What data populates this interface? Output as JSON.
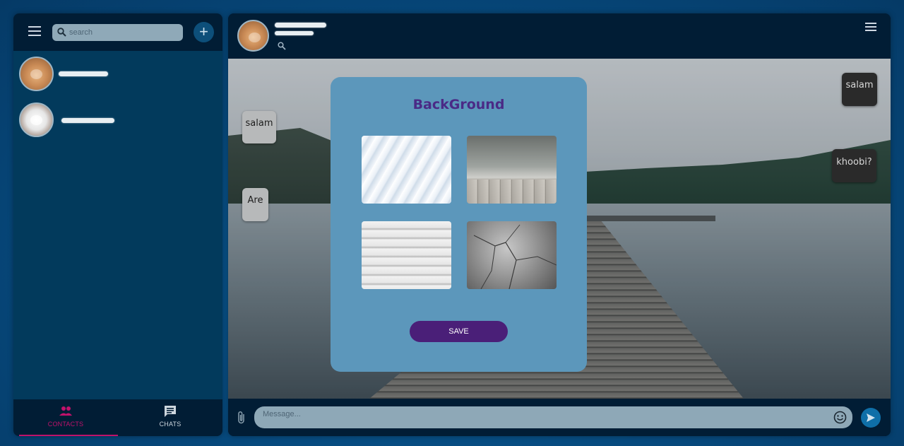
{
  "sidebar": {
    "search_placeholder": "search",
    "add_label": "+",
    "contacts": [
      {
        "avatar": "cat-avatar"
      },
      {
        "avatar": "dog-avatar"
      }
    ]
  },
  "bottom_nav": {
    "contacts_label": "CONTACTS",
    "chats_label": "CHATS",
    "active_tab": "contacts",
    "active_color": "#c1126b"
  },
  "chat": {
    "messages": [
      {
        "text": "salam",
        "direction": "incoming"
      },
      {
        "text": "Are",
        "direction": "incoming"
      },
      {
        "text": "salam",
        "direction": "outgoing"
      },
      {
        "text": "khoobi?",
        "direction": "outgoing"
      }
    ],
    "message_placeholder": "Message..."
  },
  "modal": {
    "title": "BackGround",
    "options": [
      "light-diagonal-texture",
      "wooden-deck-texture",
      "white-wood-planks",
      "cracked-concrete"
    ],
    "save_label": "SAVE"
  },
  "colors": {
    "sidebar_bg": "#023a5c",
    "header_bg": "#011d35",
    "modal_bg": "#5c97bb",
    "title_color": "#4a2a86",
    "save_button": "#4a1f78"
  }
}
